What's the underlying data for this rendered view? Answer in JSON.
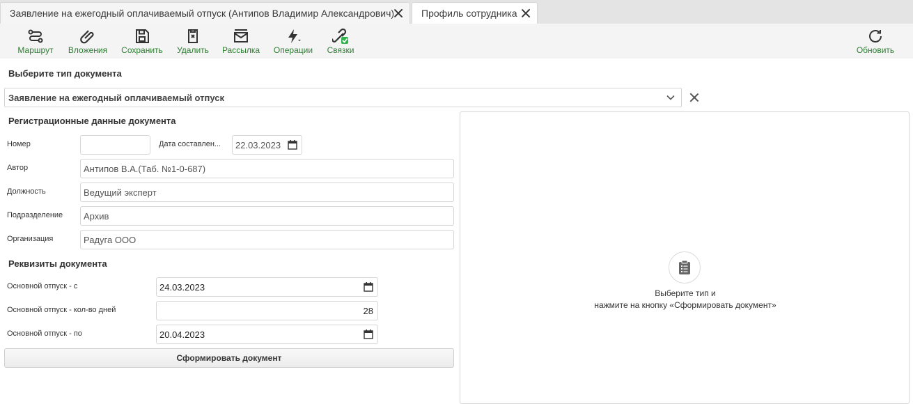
{
  "tabs": [
    {
      "label": "Заявление на ежегодный оплачиваемый отпуск (Антипов Владимир Александрович)"
    },
    {
      "label": "Профиль сотрудника"
    }
  ],
  "toolbar": {
    "route": "Маршрут",
    "attachments": "Вложения",
    "save": "Сохранить",
    "delete": "Удалить",
    "mailing": "Рассылка",
    "operations": "Операции",
    "links": "Связки",
    "refresh": "Обновить"
  },
  "doc_type": {
    "title": "Выберите тип документа",
    "value": "Заявление на ежегодный оплачиваемый отпуск"
  },
  "registration": {
    "title": "Регистрационные данные документа",
    "number_label": "Номер",
    "number_value": "",
    "date_label": "Дата составлен...",
    "date_value": "22.03.2023",
    "author_label": "Автор",
    "author_value": "Антипов В.А.(Таб. №1-0-687)",
    "position_label": "Должность",
    "position_value": "Ведущий эксперт",
    "department_label": "Подразделение",
    "department_value": "Архив",
    "organization_label": "Организация",
    "organization_value": "Радуга ООО"
  },
  "requisites": {
    "title": "Реквизиты документа",
    "from_label": "Основной отпуск - с",
    "from_value": "24.03.2023",
    "days_label": "Основной отпуск - кол-во дней",
    "days_value": "28",
    "to_label": "Основной отпуск - по",
    "to_value": "20.04.2023"
  },
  "generate_button": "Сформировать документ",
  "preview": {
    "line1": "Выберите тип и",
    "line2": "нажмите на кнопку «Сформировать документ»"
  },
  "icons": {
    "route": "route-icon",
    "attachments": "paperclip-icon",
    "save": "floppy-icon",
    "delete": "delete-icon",
    "mailing": "mail-icon",
    "operations": "lightning-icon",
    "links": "link-icon",
    "refresh": "refresh-icon",
    "calendar": "calendar-icon",
    "clipboard": "clipboard-icon"
  },
  "colors": {
    "accent": "#2e7d32",
    "links_badge": "#2db34a"
  }
}
